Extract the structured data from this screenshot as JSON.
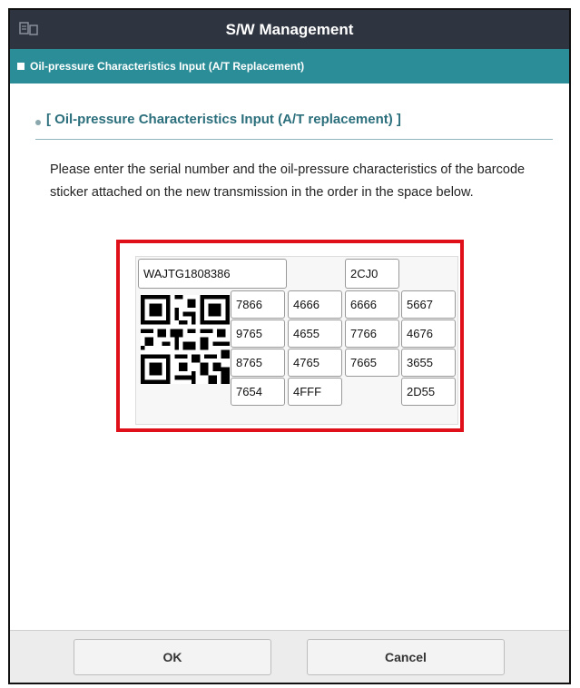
{
  "window": {
    "title": "S/W Management",
    "app_icon": "device-icon"
  },
  "subheader": {
    "label": "Oil-pressure Characteristics Input (A/T Replacement)"
  },
  "section": {
    "title": "[ Oil-pressure Characteristics Input (A/T replacement) ]"
  },
  "instructions": "Please enter the serial number and the oil-pressure characteristics of the barcode sticker attached on the new transmission in the order in the space below.",
  "sticker": {
    "serial_number": "WAJTG1808386",
    "code": "2CJ0",
    "rows": [
      [
        "7866",
        "4666",
        "6666",
        "5667"
      ],
      [
        "9765",
        "4655",
        "7766",
        "4676"
      ],
      [
        "8765",
        "4765",
        "7665",
        "3655"
      ],
      [
        "7654",
        "4FFF",
        "",
        "2D55"
      ]
    ],
    "barcode_icon": "qr-code-icon"
  },
  "buttons": {
    "ok": "OK",
    "cancel": "Cancel"
  },
  "colors": {
    "title_bar": "#2f3540",
    "subheader": "#2b8d97",
    "section_text": "#2b6f7c",
    "highlight_border": "#e0101a"
  }
}
